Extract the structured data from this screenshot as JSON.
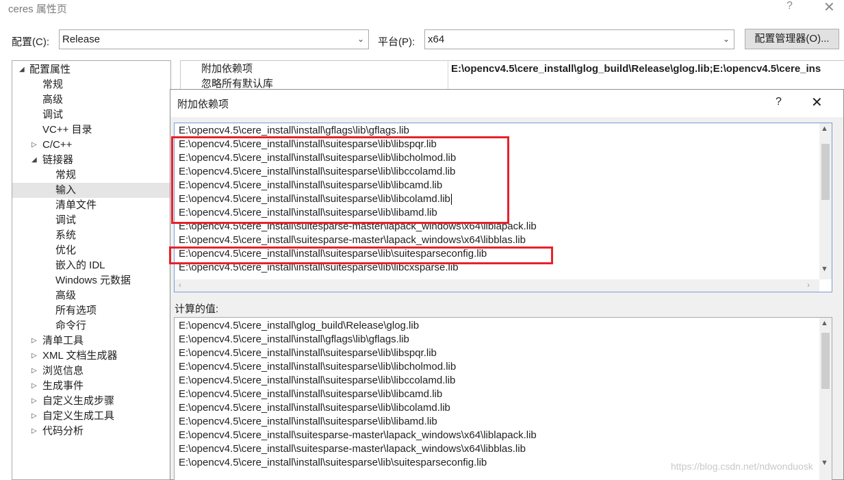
{
  "window": {
    "title": "ceres 属性页",
    "help": "?",
    "close": "✕"
  },
  "config": {
    "config_label": "配置(C):",
    "config_value": "Release",
    "platform_label": "平台(P):",
    "platform_value": "x64",
    "manager_button": "配置管理器(O)..."
  },
  "tree": {
    "root": "配置属性",
    "items": [
      "常规",
      "高级",
      "调试",
      "VC++ 目录",
      "C/C++",
      "链接器",
      "常规",
      "输入",
      "清单文件",
      "调试",
      "系统",
      "优化",
      "嵌入的 IDL",
      "Windows 元数据",
      "高级",
      "所有选项",
      "命令行",
      "清单工具",
      "XML 文档生成器",
      "浏览信息",
      "生成事件",
      "自定义生成步骤",
      "自定义生成工具",
      "代码分析"
    ]
  },
  "grid": {
    "row1_name": "附加依赖项",
    "row1_value": "E:\\opencv4.5\\cere_install\\glog_build\\Release\\glog.lib;E:\\opencv4.5\\cere_ins",
    "row2_name": "忽略所有默认库"
  },
  "dialog": {
    "title": "附加依赖项",
    "help": "?",
    "close": "✕",
    "edit_lines": [
      "E:\\opencv4.5\\cere_install\\install\\gflags\\lib\\gflags.lib",
      "E:\\opencv4.5\\cere_install\\install\\suitesparse\\lib\\libspqr.lib",
      "E:\\opencv4.5\\cere_install\\install\\suitesparse\\lib\\libcholmod.lib",
      "E:\\opencv4.5\\cere_install\\install\\suitesparse\\lib\\libccolamd.lib",
      "E:\\opencv4.5\\cere_install\\install\\suitesparse\\lib\\libcamd.lib",
      "E:\\opencv4.5\\cere_install\\install\\suitesparse\\lib\\libcolamd.lib",
      "E:\\opencv4.5\\cere_install\\install\\suitesparse\\lib\\libamd.lib",
      "E:\\opencv4.5\\cere_install\\suitesparse-master\\lapack_windows\\x64\\liblapack.lib",
      "E:\\opencv4.5\\cere_install\\suitesparse-master\\lapack_windows\\x64\\libblas.lib",
      "E:\\opencv4.5\\cere_install\\install\\suitesparse\\lib\\suitesparseconfig.lib",
      "E:\\opencv4.5\\cere_install\\install\\suitesparse\\lib\\libcxsparse.lib"
    ],
    "calc_label": "计算的值:",
    "calc_lines": [
      "E:\\opencv4.5\\cere_install\\glog_build\\Release\\glog.lib",
      "E:\\opencv4.5\\cere_install\\install\\gflags\\lib\\gflags.lib",
      "E:\\opencv4.5\\cere_install\\install\\suitesparse\\lib\\libspqr.lib",
      "E:\\opencv4.5\\cere_install\\install\\suitesparse\\lib\\libcholmod.lib",
      "E:\\opencv4.5\\cere_install\\install\\suitesparse\\lib\\libccolamd.lib",
      "E:\\opencv4.5\\cere_install\\install\\suitesparse\\lib\\libcamd.lib",
      "E:\\opencv4.5\\cere_install\\install\\suitesparse\\lib\\libcolamd.lib",
      "E:\\opencv4.5\\cere_install\\install\\suitesparse\\lib\\libamd.lib",
      "E:\\opencv4.5\\cere_install\\suitesparse-master\\lapack_windows\\x64\\liblapack.lib",
      "E:\\opencv4.5\\cere_install\\suitesparse-master\\lapack_windows\\x64\\libblas.lib",
      "E:\\opencv4.5\\cere_install\\install\\suitesparse\\lib\\suitesparseconfig.lib"
    ]
  },
  "watermark": "https://blog.csdn.net/ndwonduosk",
  "colors": {
    "highlight_box": "#e8202a",
    "selection": "#e5e5e5"
  }
}
